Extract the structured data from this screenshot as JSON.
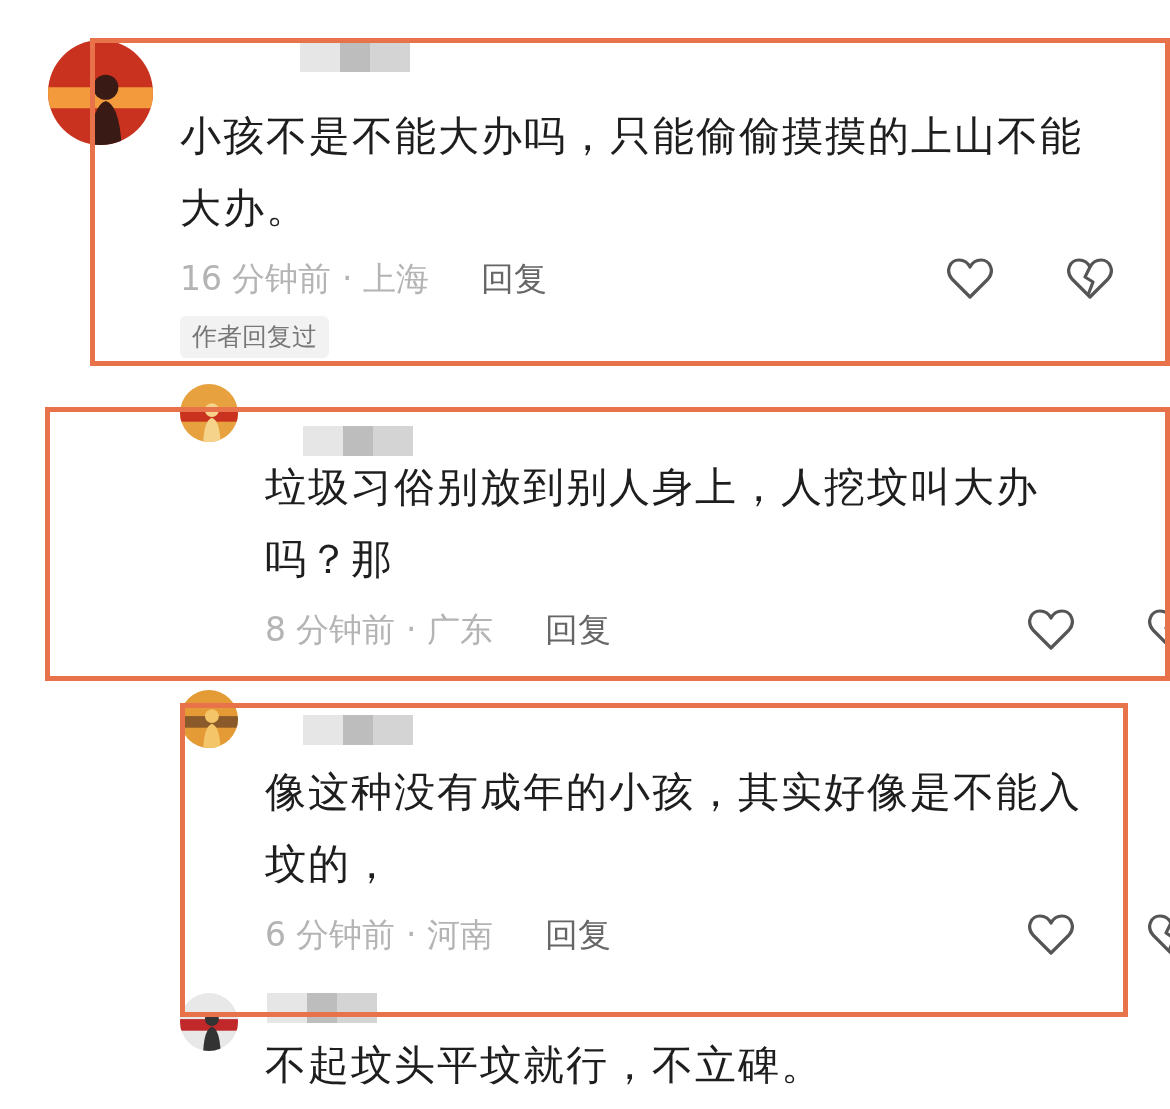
{
  "comments": [
    {
      "kind": "comment",
      "text": "小孩不是不能大办吗，只能偷偷摸摸的上山不能大办。",
      "time_location": "16 分钟前 · 上海",
      "reply": "回复",
      "tag": "作者回复过",
      "highlighted": true
    },
    {
      "kind": "reply",
      "text": "垃圾习俗别放到别人身上，人挖坟叫大办吗？那",
      "time_location": "8 分钟前 · 广东",
      "reply": "回复",
      "highlighted": true
    },
    {
      "kind": "reply",
      "text": "像这种没有成年的小孩，其实好像是不能入坟的，",
      "time_location": "6 分钟前 · 河南",
      "reply": "回复",
      "highlighted": true
    },
    {
      "kind": "reply",
      "text": "不起坟头平坟就行，不立碑。",
      "highlighted": false
    }
  ]
}
